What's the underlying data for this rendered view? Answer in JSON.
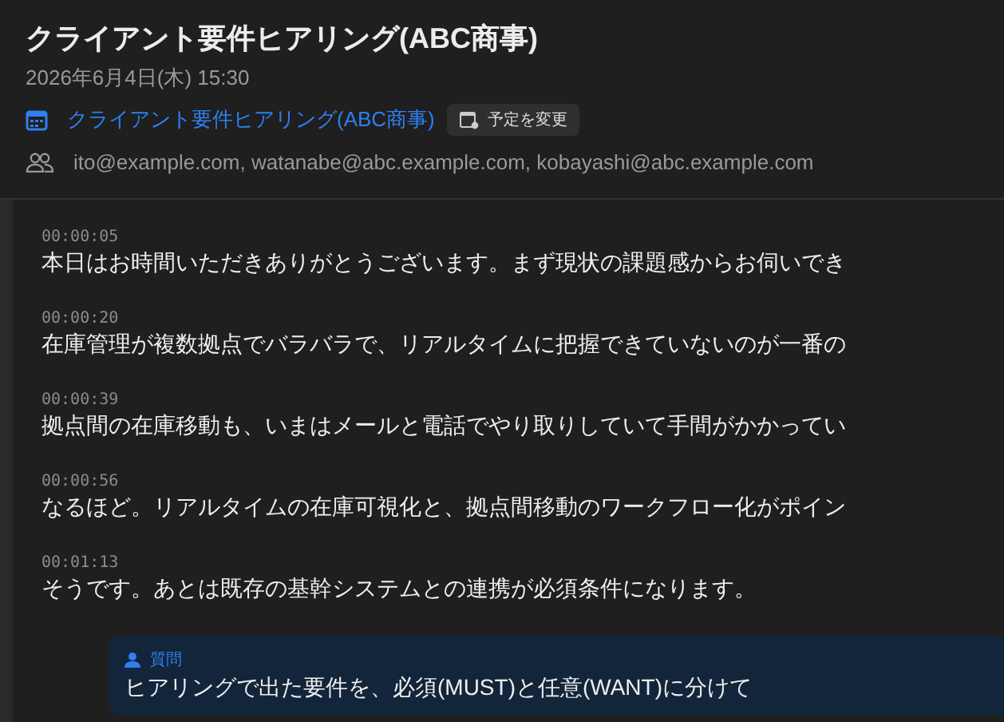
{
  "header": {
    "title": "クライアント要件ヒアリング(ABC商事)",
    "datetime": "2026年6月4日(木) 15:30",
    "event_link": "クライアント要件ヒアリング(ABC商事)",
    "reschedule_button": "予定を変更",
    "attendees": "ito@example.com, watanabe@abc.example.com, kobayashi@abc.example.com"
  },
  "transcript": [
    {
      "time": "00:00:05",
      "text": "本日はお時間いただきありがとうございます。まず現状の課題感からお伺いでき"
    },
    {
      "time": "00:00:20",
      "text": "在庫管理が複数拠点でバラバラで、リアルタイムに把握できていないのが一番の"
    },
    {
      "time": "00:00:39",
      "text": "拠点間の在庫移動も、いまはメールと電話でやり取りしていて手間がかかってい"
    },
    {
      "time": "00:00:56",
      "text": "なるほど。リアルタイムの在庫可視化と、拠点間移動のワークフロー化がポイン"
    },
    {
      "time": "00:01:13",
      "text": "そうです。あとは既存の基幹システムとの連携が必須条件になります。"
    }
  ],
  "question_card": {
    "label": "質問",
    "text": "ヒアリングで出た要件を、必須(MUST)と任意(WANT)に分けて"
  }
}
